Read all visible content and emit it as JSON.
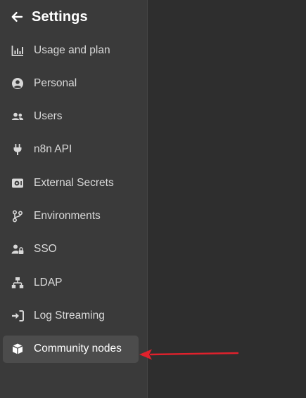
{
  "header": {
    "title": "Settings"
  },
  "menu": {
    "items": [
      {
        "label": "Usage and plan",
        "icon": "bar-chart-icon",
        "active": false
      },
      {
        "label": "Personal",
        "icon": "user-circle-icon",
        "active": false
      },
      {
        "label": "Users",
        "icon": "users-icon",
        "active": false
      },
      {
        "label": "n8n API",
        "icon": "plug-icon",
        "active": false
      },
      {
        "label": "External Secrets",
        "icon": "vault-icon",
        "active": false
      },
      {
        "label": "Environments",
        "icon": "branch-icon",
        "active": false
      },
      {
        "label": "SSO",
        "icon": "user-lock-icon",
        "active": false
      },
      {
        "label": "LDAP",
        "icon": "network-icon",
        "active": false
      },
      {
        "label": "Log Streaming",
        "icon": "sign-in-icon",
        "active": false
      },
      {
        "label": "Community nodes",
        "icon": "cube-icon",
        "active": true
      }
    ]
  },
  "colors": {
    "sidebar_bg": "#3a3a3a",
    "content_bg": "#2e2e2e",
    "active_bg": "#4c4c4c",
    "text": "#d8d8d8",
    "annotation_arrow": "#e0212c"
  }
}
